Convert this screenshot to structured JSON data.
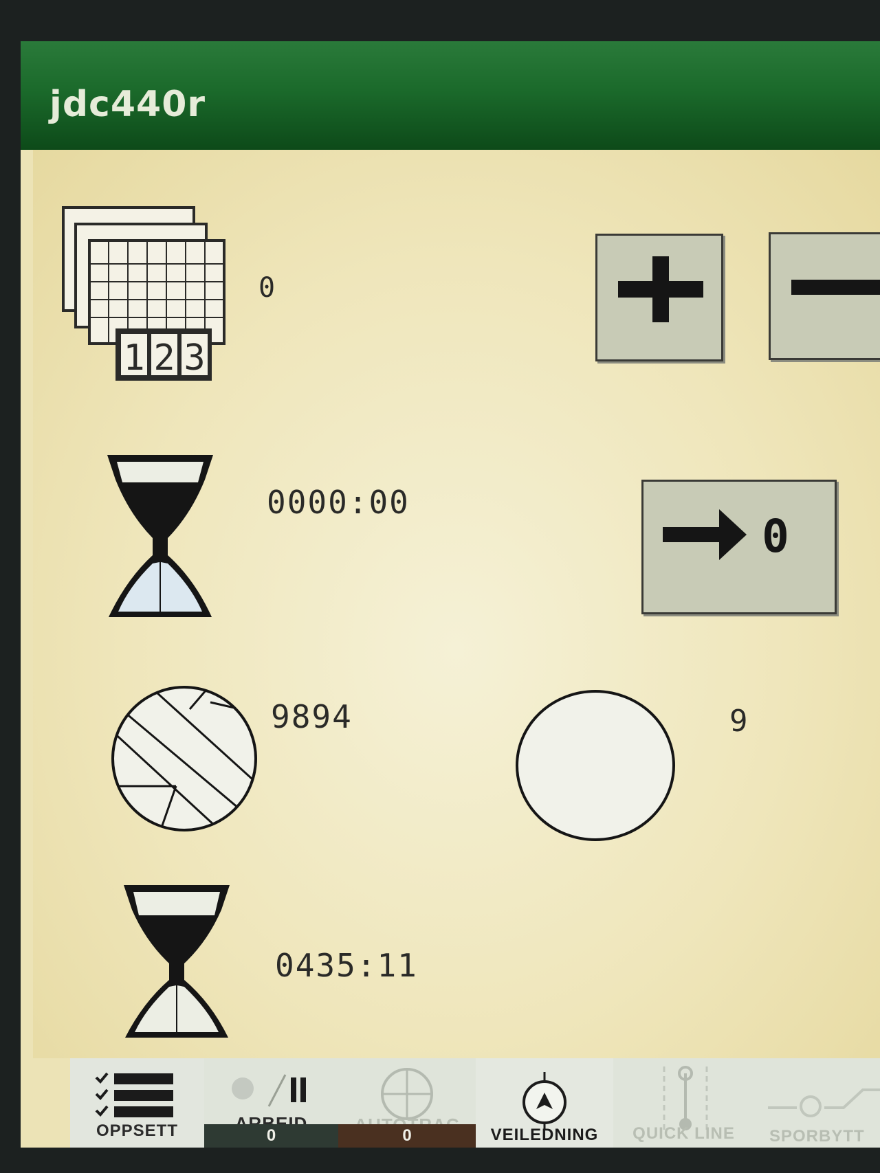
{
  "titlebar": {
    "title": "jdc440r"
  },
  "rows": {
    "counter_value": "0",
    "timer1_value": "0000:00",
    "bale_count": "9894",
    "circle_value": "9",
    "timer2_value": "0435:11"
  },
  "counter_icon": {
    "digits": [
      "1",
      "2",
      "3"
    ]
  },
  "buttons": {
    "increment_icon": "plus-icon",
    "decrement_icon": "minus-icon",
    "reset_icon": "arrow-to-zero-icon",
    "reset_target": "0"
  },
  "softkeys": {
    "oppsett": {
      "label": "OPPSETT"
    },
    "arbeid": {
      "label": "ARBEID",
      "counter": "0"
    },
    "autotrac": {
      "label": "AUTOTRAC",
      "counter": "0"
    },
    "veiledning": {
      "label": "VEILEDNING"
    },
    "quickline": {
      "label": "QUICK LINE"
    },
    "sporbytte": {
      "label": "SPORBYTT"
    }
  },
  "colors": {
    "titlebar": "#1b6a2b",
    "background": "#efe6bb",
    "button": "#c8cbb6",
    "counter_strip_dark": "#2e3a33",
    "counter_strip_brown": "#4a3020"
  }
}
